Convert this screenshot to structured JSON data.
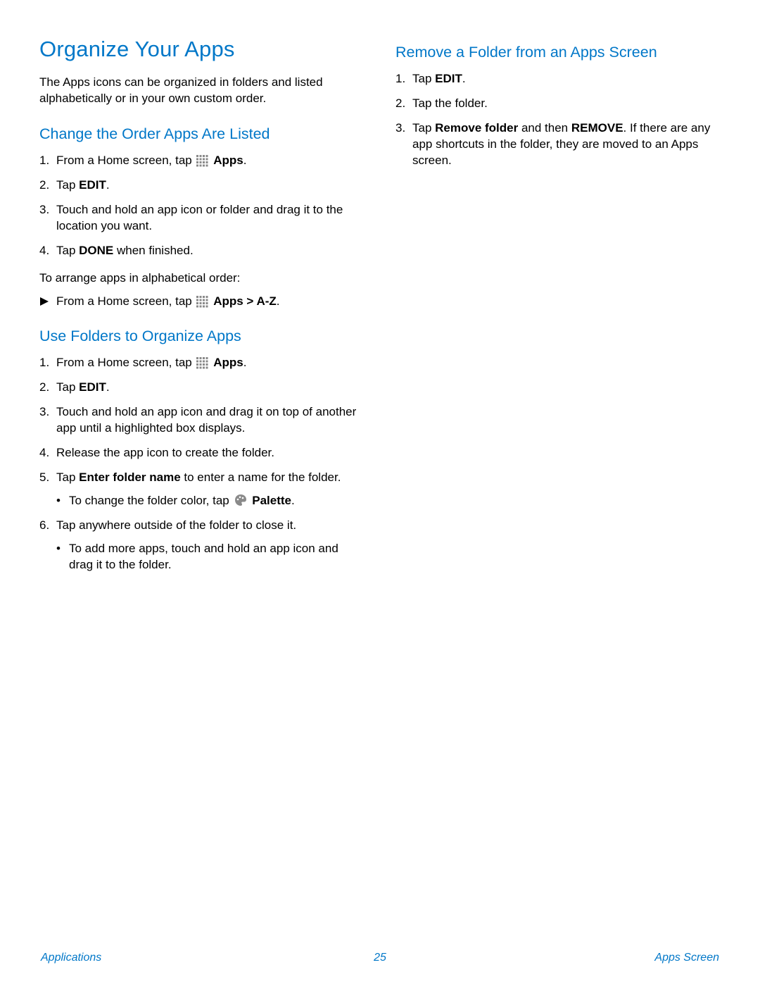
{
  "title": "Organize Your Apps",
  "intro": "The Apps icons can be organized in folders and listed alphabetically or in your own custom order.",
  "sectionA": {
    "title": "Change the Order Apps Are Listed",
    "steps": [
      {
        "num": "1.",
        "prefix": "From a Home screen, tap ",
        "icon": "apps-grid",
        "bold1": "Apps",
        "suffix": "."
      },
      {
        "num": "2.",
        "prefix": "Tap ",
        "bold1": "EDIT",
        "suffix": "."
      },
      {
        "num": "3.",
        "text": "Touch and hold an app icon or folder and drag it to the location you want."
      },
      {
        "num": "4.",
        "prefix": "Tap ",
        "bold1": "DONE",
        "suffix": " when finished."
      }
    ],
    "subnote": "To arrange apps in alphabetical order:",
    "alpha": {
      "prefix": "From a Home screen, tap ",
      "icon": "apps-grid",
      "bold1": "Apps > A-Z",
      "suffix": "."
    }
  },
  "sectionB": {
    "title": "Use Folders to Organize Apps",
    "steps": [
      {
        "num": "1.",
        "prefix": "From a Home screen, tap ",
        "icon": "apps-grid",
        "bold1": "Apps",
        "suffix": "."
      },
      {
        "num": "2.",
        "prefix": "Tap ",
        "bold1": "EDIT",
        "suffix": "."
      },
      {
        "num": "3.",
        "text": "Touch and hold an app icon and drag it on top of another app until a highlighted box displays."
      },
      {
        "num": "4.",
        "text": "Release the app icon to create the folder."
      },
      {
        "num": "5.",
        "prefix": "Tap ",
        "bold1": "Enter folder name",
        "suffix": " to enter a name for the folder.",
        "sub": [
          {
            "prefix": "To change the folder color, tap ",
            "icon": "palette",
            "bold1": "Palette",
            "suffix": "."
          }
        ]
      },
      {
        "num": "6.",
        "text": "Tap anywhere outside of the folder to close it.",
        "sub": [
          {
            "text": "To add more apps, touch and hold an app icon and drag it to the folder."
          }
        ]
      }
    ]
  },
  "sectionC": {
    "title": "Remove a Folder from an Apps Screen",
    "steps": [
      {
        "num": "1.",
        "prefix": "Tap ",
        "bold1": "EDIT",
        "suffix": "."
      },
      {
        "num": "2.",
        "text": "Tap the folder."
      },
      {
        "num": "3.",
        "prefix": "Tap ",
        "bold1": "Remove folder",
        "mid": " and then ",
        "bold2": "REMOVE",
        "suffix": ". If there are any app shortcuts in the folder, they are moved to an Apps screen."
      }
    ]
  },
  "footer": {
    "left": "Applications",
    "center": "25",
    "right": "Apps Screen"
  },
  "colors": {
    "accent": "#0077c8"
  }
}
